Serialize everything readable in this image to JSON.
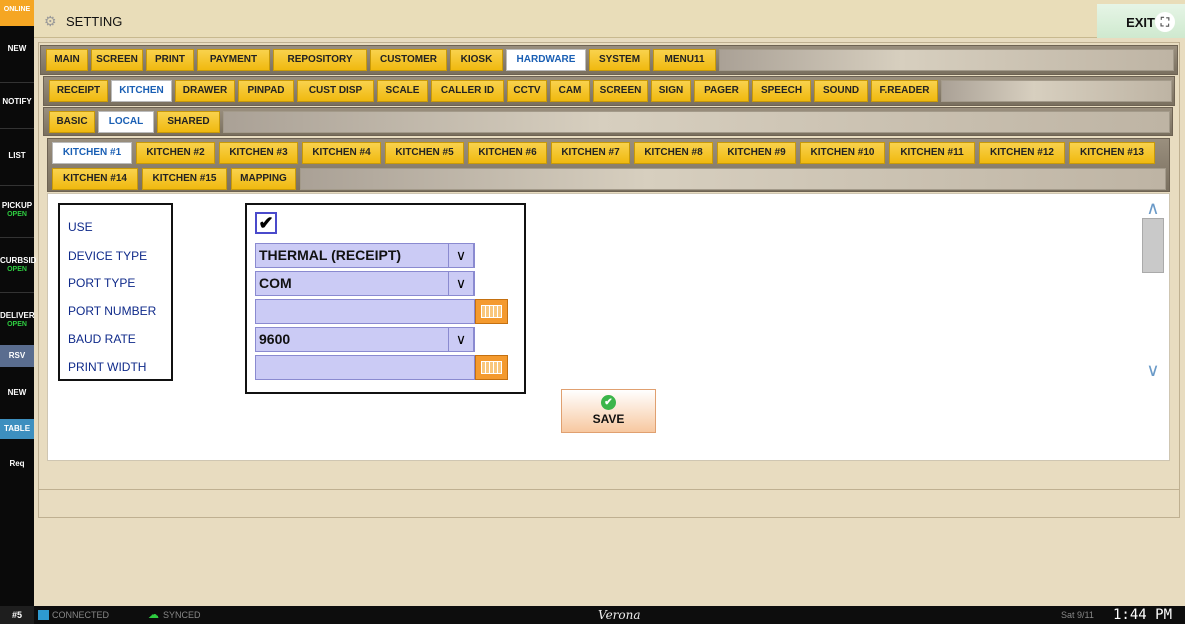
{
  "sidebar": {
    "online": "ONLINE",
    "items": [
      {
        "label": "NEW",
        "sub": ""
      },
      {
        "label": "NOTIFY",
        "sub": ""
      },
      {
        "label": "LIST",
        "sub": ""
      },
      {
        "label": "PICKUP",
        "sub": "OPEN"
      },
      {
        "label": "CURBSID",
        "sub": "OPEN"
      },
      {
        "label": "DELIVER",
        "sub": "OPEN"
      },
      {
        "label": "RSV",
        "sub": ""
      },
      {
        "label": "NEW",
        "sub": ""
      },
      {
        "label": "TABLE",
        "sub": ""
      },
      {
        "label": "Req",
        "sub": ""
      }
    ]
  },
  "header": {
    "title": "SETTING",
    "exit_label": "EXIT",
    "icons": {
      "gear": "gear-icon",
      "exit": "fullscreen-icon"
    }
  },
  "tabs_main": {
    "items": [
      "MAIN",
      "SCREEN",
      "PRINT",
      "PAYMENT",
      "REPOSITORY",
      "CUSTOMER",
      "KIOSK",
      "HARDWARE",
      "SYSTEM",
      "MENU11"
    ],
    "active": "HARDWARE"
  },
  "tabs_hardware": {
    "items": [
      "RECEIPT",
      "KITCHEN",
      "DRAWER",
      "PINPAD",
      "CUST DISP",
      "SCALE",
      "CALLER ID",
      "CCTV",
      "CAM",
      "SCREEN",
      "SIGN",
      "PAGER",
      "SPEECH",
      "SOUND",
      "F.READER"
    ],
    "active": "KITCHEN"
  },
  "tabs_scope": {
    "items": [
      "BASIC",
      "LOCAL",
      "SHARED"
    ],
    "active": "LOCAL"
  },
  "tabs_kitchen": {
    "row1": [
      "KITCHEN #1",
      "KITCHEN #2",
      "KITCHEN #3",
      "KITCHEN #4",
      "KITCHEN #5",
      "KITCHEN #6",
      "KITCHEN #7",
      "KITCHEN #8",
      "KITCHEN #9",
      "KITCHEN #10",
      "KITCHEN #11",
      "KITCHEN #12",
      "KITCHEN #13"
    ],
    "row2": [
      "KITCHEN #14",
      "KITCHEN #15",
      "MAPPING"
    ],
    "active": "KITCHEN #1"
  },
  "form": {
    "labels": [
      "USE",
      "DEVICE TYPE",
      "PORT TYPE",
      "PORT NUMBER",
      "BAUD RATE",
      "PRINT WIDTH"
    ],
    "use_checked": true,
    "check_glyph": "✔",
    "device_type": "THERMAL (RECEIPT)",
    "port_type": "COM",
    "port_number": "",
    "baud_rate": "9600",
    "print_width": "",
    "dropdown_glyph": "∨",
    "field_color": "#cbcbf5",
    "keyboard_icon": "keyboard-icon"
  },
  "save": {
    "label": "SAVE",
    "icon": "check-circle-icon",
    "check": "✔"
  },
  "scroll": {
    "up": "∧",
    "down": "∨"
  },
  "status": {
    "station": "#5",
    "connected": "CONNECTED",
    "synced": "SYNCED",
    "store": "Verona",
    "date": "Sat 9/11",
    "time": "1:44 PM"
  },
  "colors": {
    "tab": "#f0b90f",
    "active_tab_text": "#1a5fb4",
    "label_text": "#0f2a8a",
    "open_status": "#2ecc40"
  }
}
